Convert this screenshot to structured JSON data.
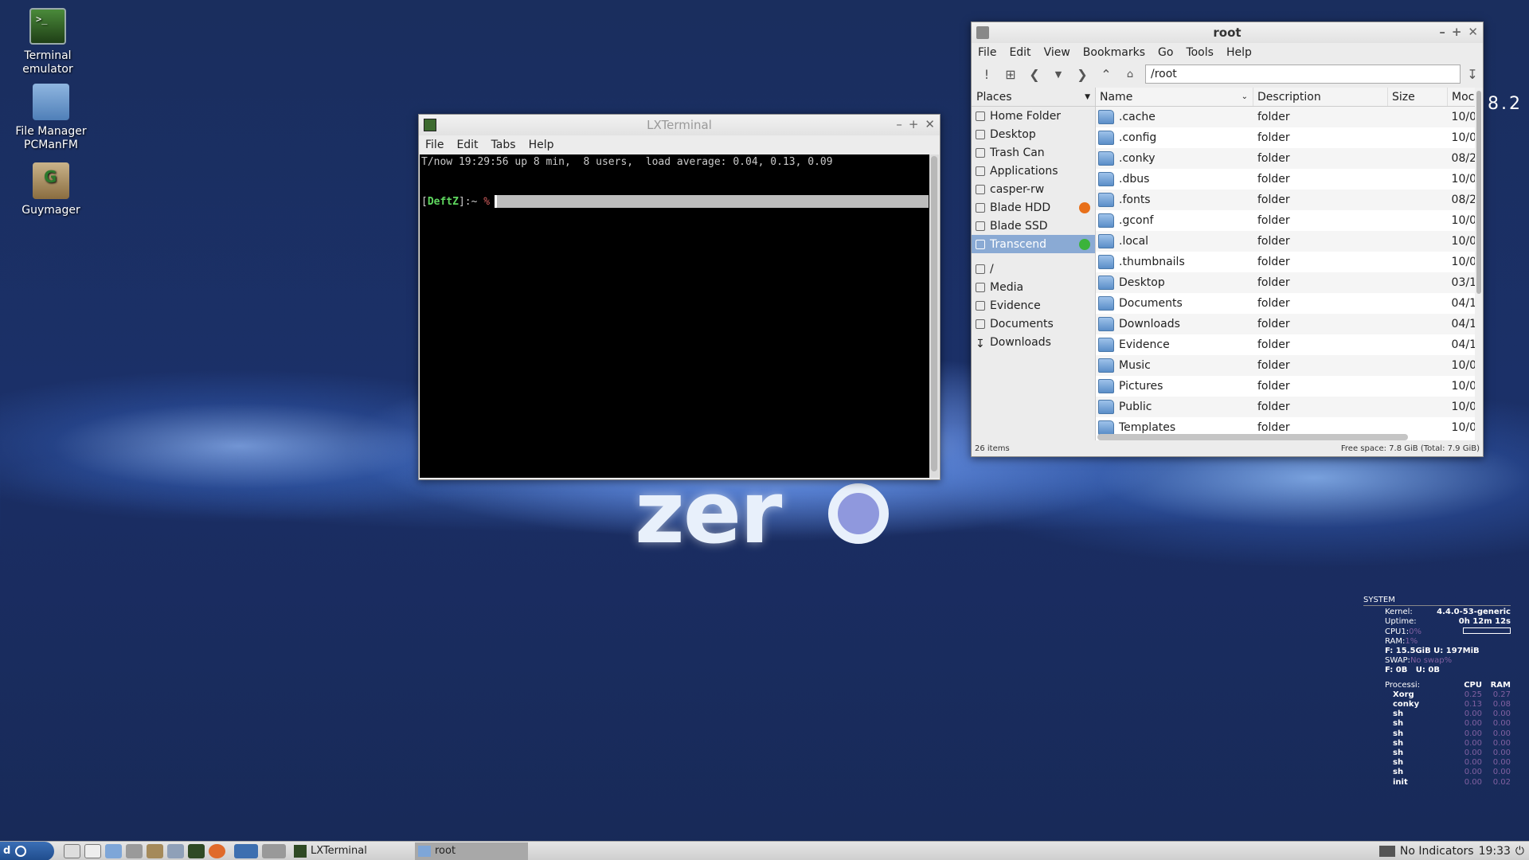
{
  "desktop": {
    "icons": [
      {
        "label": "Terminal emulator"
      },
      {
        "label": "File Manager PCManFM"
      },
      {
        "label": "Guymager"
      }
    ],
    "logo_text": "zer",
    "version_fragment": "8.2"
  },
  "terminal": {
    "title": "LXTerminal",
    "menu": [
      "File",
      "Edit",
      "Tabs",
      "Help"
    ],
    "line1": "T/now 19:29:56 up 8 min,  8 users,  load average: 0.04, 0.13, 0.09",
    "prompt_open": "[",
    "prompt_user": "DeftZ",
    "prompt_close": "]:~ ",
    "prompt_symbol": "%"
  },
  "file_manager": {
    "title": "root",
    "menu": [
      "File",
      "Edit",
      "View",
      "Bookmarks",
      "Go",
      "Tools",
      "Help"
    ],
    "path": "/root",
    "places_label": "Places",
    "places": [
      "Home Folder",
      "Desktop",
      "Trash Can",
      "Applications",
      "casper-rw",
      "Blade HDD",
      "Blade SSD",
      "Transcend"
    ],
    "bookmarks": [
      "/",
      "Media",
      "Evidence",
      "Documents",
      "Downloads"
    ],
    "columns": [
      "Name",
      "Description",
      "Size",
      "Moc"
    ],
    "files": [
      {
        "name": ".cache",
        "desc": "folder",
        "mod": "10/0"
      },
      {
        "name": ".config",
        "desc": "folder",
        "mod": "10/0"
      },
      {
        "name": ".conky",
        "desc": "folder",
        "mod": "08/2"
      },
      {
        "name": ".dbus",
        "desc": "folder",
        "mod": "10/0"
      },
      {
        "name": ".fonts",
        "desc": "folder",
        "mod": "08/2"
      },
      {
        "name": ".gconf",
        "desc": "folder",
        "mod": "10/0"
      },
      {
        "name": ".local",
        "desc": "folder",
        "mod": "10/0"
      },
      {
        "name": ".thumbnails",
        "desc": "folder",
        "mod": "10/0"
      },
      {
        "name": "Desktop",
        "desc": "folder",
        "mod": "03/1"
      },
      {
        "name": "Documents",
        "desc": "folder",
        "mod": "04/1"
      },
      {
        "name": "Downloads",
        "desc": "folder",
        "mod": "04/1"
      },
      {
        "name": "Evidence",
        "desc": "folder",
        "mod": "04/1"
      },
      {
        "name": "Music",
        "desc": "folder",
        "mod": "10/0"
      },
      {
        "name": "Pictures",
        "desc": "folder",
        "mod": "10/0"
      },
      {
        "name": "Public",
        "desc": "folder",
        "mod": "10/0"
      },
      {
        "name": "Templates",
        "desc": "folder",
        "mod": "10/0"
      }
    ],
    "status_items": "26 items",
    "status_free": "Free space: 7.8 GiB (Total: 7.9 GiB)"
  },
  "conky": {
    "header": "SYSTEM",
    "kernel_label": "Kernel:",
    "kernel": "4.4.0-53-generic",
    "uptime_label": "Uptime:",
    "uptime": "0h 12m 12s",
    "cpu_label": "CPU1:",
    "cpu": "0%",
    "ram_label": "RAM:",
    "ram": "1%",
    "fs_line": "F: 15.5GiB U: 197MiB",
    "swap_label": "SWAP:",
    "swap": "No swap%",
    "swap_fs": "F: 0B   U: 0B",
    "proc_header": {
      "name": "Processi:",
      "cpu": "CPU",
      "ram": "RAM"
    },
    "processes": [
      {
        "name": "Xorg",
        "cpu": "0.25",
        "ram": "0.27"
      },
      {
        "name": "conky",
        "cpu": "0.13",
        "ram": "0.08"
      },
      {
        "name": "sh",
        "cpu": "0.00",
        "ram": "0.00"
      },
      {
        "name": "sh",
        "cpu": "0.00",
        "ram": "0.00"
      },
      {
        "name": "sh",
        "cpu": "0.00",
        "ram": "0.00"
      },
      {
        "name": "sh",
        "cpu": "0.00",
        "ram": "0.00"
      },
      {
        "name": "sh",
        "cpu": "0.00",
        "ram": "0.00"
      },
      {
        "name": "sh",
        "cpu": "0.00",
        "ram": "0.00"
      },
      {
        "name": "sh",
        "cpu": "0.00",
        "ram": "0.00"
      },
      {
        "name": "init",
        "cpu": "0.00",
        "ram": "0.02"
      }
    ]
  },
  "taskbar": {
    "start_label": "d",
    "tasks": [
      "LXTerminal",
      "root"
    ],
    "indicator": "No Indicators",
    "clock": "19:33"
  },
  "colors": {
    "accent": "#8aaad4",
    "eject_orange": "#e8701a",
    "eject_green": "#3bb33b"
  }
}
